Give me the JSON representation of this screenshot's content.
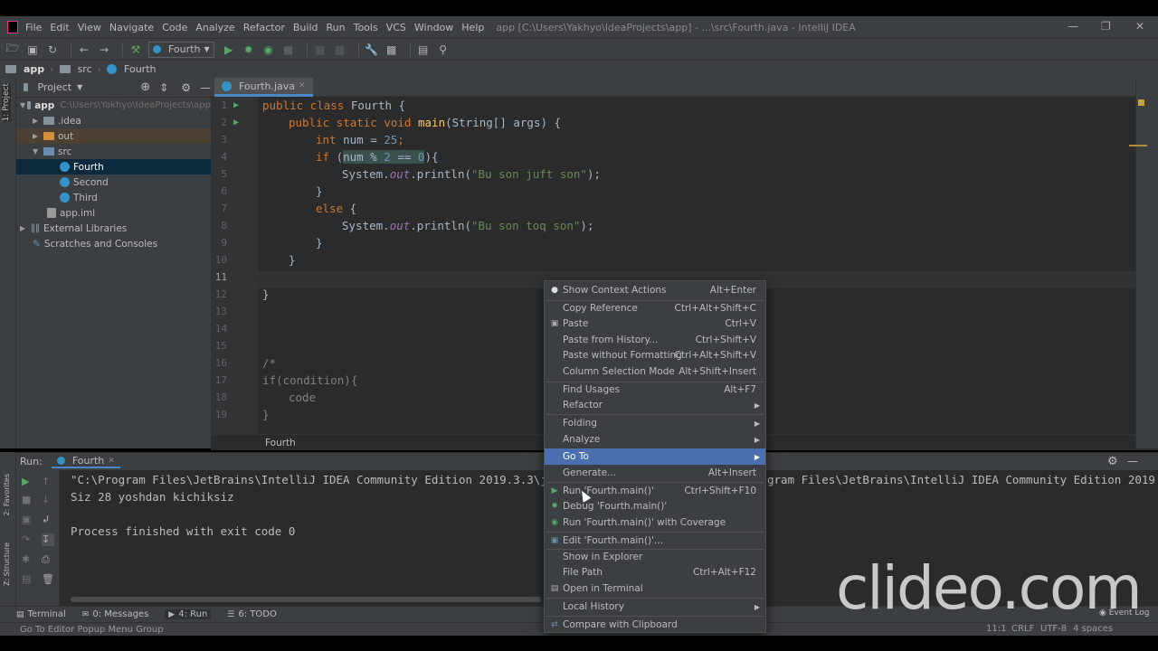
{
  "window": {
    "title": "app [C:\\Users\\Yakhyo\\IdeaProjects\\app] - ...\\src\\Fourth.java - IntelliJ IDEA",
    "menu": [
      "File",
      "Edit",
      "View",
      "Navigate",
      "Code",
      "Analyze",
      "Refactor",
      "Build",
      "Run",
      "Tools",
      "VCS",
      "Window",
      "Help"
    ]
  },
  "toolbar": {
    "run_config": "Fourth"
  },
  "navbar": {
    "crumbs": [
      "app",
      "src",
      "Fourth"
    ]
  },
  "project": {
    "header": "Project",
    "tree": [
      {
        "label": "app",
        "hint": "C:\\Users\\Yakhyo\\IdeaProjects\\app"
      },
      {
        "label": ".idea"
      },
      {
        "label": "out"
      },
      {
        "label": "src"
      },
      {
        "label": "Fourth"
      },
      {
        "label": "Second"
      },
      {
        "label": "Third"
      },
      {
        "label": "app.iml"
      },
      {
        "label": "External Libraries"
      },
      {
        "label": "Scratches and Consoles"
      }
    ]
  },
  "left_strip": {
    "project_tab": "1: Project",
    "favorites_tab": "2: Favorites",
    "structure_tab": "Z: Structure"
  },
  "editor": {
    "tab": "Fourth.java",
    "line_numbers": [
      "1",
      "2",
      "3",
      "4",
      "5",
      "6",
      "7",
      "8",
      "9",
      "10",
      "11",
      "12",
      "13",
      "14",
      "15",
      "16",
      "17",
      "18",
      "19"
    ],
    "breadcrumb": "Fourth",
    "code": {
      "l1_kw": "public class ",
      "l1_name": "Fourth {",
      "l2_kw": "public static void ",
      "l2_fn": "main",
      "l2_rest": "(String[] args) {",
      "l3_kw": "int ",
      "l3_rest": "num = ",
      "l3_num": "25",
      "l3_end": ";",
      "l4_kw": "if ",
      "l4_open": "(",
      "l4_var": "num % ",
      "l4_n1": "2",
      "l4_eq": " == ",
      "l4_n2": "0",
      "l4_close": "){",
      "l5_pre": "System.",
      "l5_out": "out",
      "l5_mid": ".println(",
      "l5_str": "\"Bu son juft son\"",
      "l5_end": ");",
      "l6": "}",
      "l7_kw": "else ",
      "l7_rest": "{",
      "l8_pre": "System.",
      "l8_out": "out",
      "l8_mid": ".println(",
      "l8_str": "\"Bu son toq son\"",
      "l8_end": ");",
      "l9": "}",
      "l10": "}",
      "l12": "}",
      "l16": "/*",
      "l17": "if(condition){",
      "l18": "code",
      "l19": "}"
    }
  },
  "run_panel": {
    "label": "Run:",
    "tab": "Fourth",
    "console": [
      "\"C:\\Program Files\\JetBrains\\IntelliJ IDEA Community Edition 2019.3.3\\jbr",
      "gram Files\\JetBrains\\IntelliJ IDEA Community Edition 2019",
      "Siz 28 yoshdan kichiksiz",
      "Process finished with exit code 0"
    ]
  },
  "context_menu": {
    "items": [
      {
        "label": "Show Context Actions",
        "shortcut": "Alt+Enter",
        "icon": "bulb-icon"
      },
      {
        "label": "Copy Reference",
        "shortcut": "Ctrl+Alt+Shift+C"
      },
      {
        "label": "Paste",
        "shortcut": "Ctrl+V",
        "icon": "clipboard-icon"
      },
      {
        "label": "Paste from History...",
        "shortcut": "Ctrl+Shift+V"
      },
      {
        "label": "Paste without Formatting",
        "shortcut": "Ctrl+Alt+Shift+V"
      },
      {
        "label": "Column Selection Mode",
        "shortcut": "Alt+Shift+Insert"
      },
      {
        "label": "Find Usages",
        "shortcut": "Alt+F7"
      },
      {
        "label": "Refactor",
        "submenu": true
      },
      {
        "label": "Folding",
        "submenu": true
      },
      {
        "label": "Analyze",
        "submenu": true
      },
      {
        "label": "Go To",
        "submenu": true,
        "selected": true
      },
      {
        "label": "Generate...",
        "shortcut": "Alt+Insert"
      },
      {
        "label": "Run 'Fourth.main()'",
        "shortcut": "Ctrl+Shift+F10",
        "icon": "run-icon"
      },
      {
        "label": "Debug 'Fourth.main()'",
        "icon": "debug-icon"
      },
      {
        "label": "Run 'Fourth.main()' with Coverage",
        "icon": "coverage-icon"
      },
      {
        "label": "Edit 'Fourth.main()'...",
        "icon": "edit-config-icon"
      },
      {
        "label": "Show in Explorer"
      },
      {
        "label": "File Path",
        "shortcut": "Ctrl+Alt+F12"
      },
      {
        "label": "Open in Terminal",
        "icon": "terminal-icon"
      },
      {
        "label": "Local History",
        "submenu": true
      },
      {
        "label": "Compare with Clipboard",
        "icon": "compare-icon"
      }
    ]
  },
  "tool_windows": [
    "Terminal",
    "0: Messages",
    "4: Run",
    "6: TODO"
  ],
  "status": {
    "message": "Go To Editor Popup Menu Group",
    "position": "11:1",
    "line_sep": "CRLF",
    "encoding": "UTF-8",
    "indent": "4 spaces",
    "event_log": "Event Log"
  },
  "watermark": "clideo.com",
  "colors": {
    "accent": "#4b6eaf",
    "tab_underline": "#4a88c7",
    "keyword": "#cc7832",
    "string": "#6a8759",
    "number": "#6897bb",
    "function": "#ffc66d"
  }
}
